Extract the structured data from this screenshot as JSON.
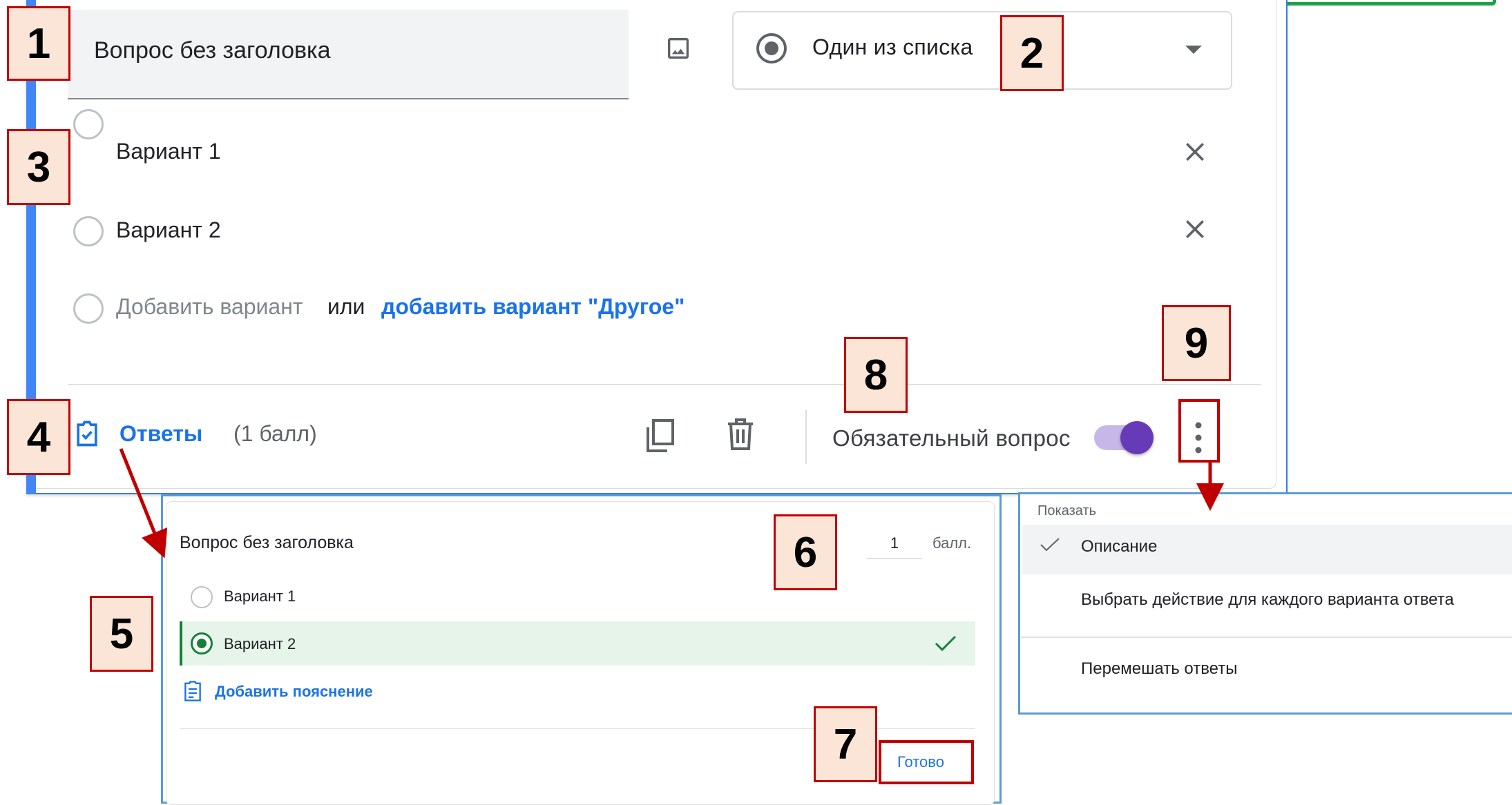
{
  "question": {
    "title": "Вопрос без заголовка",
    "type_label": "Один из списка",
    "options": [
      "Вариант 1",
      "Вариант 2"
    ],
    "add_option": "Добавить вариант",
    "or": "или",
    "add_other": "добавить вариант \"Другое\""
  },
  "footer": {
    "answers_label": "Ответы",
    "points": "(1 балл)",
    "required_label": "Обязательный вопрос",
    "required_on": true
  },
  "answers_panel": {
    "title": "Вопрос без заголовка",
    "points_value": "1",
    "points_unit": "балл.",
    "options": [
      "Вариант 1",
      "Вариант 2"
    ],
    "correct_option": "Вариант 2",
    "add_explanation": "Добавить пояснение",
    "done": "Готово"
  },
  "more_menu": {
    "header": "Показать",
    "items": [
      "Описание",
      "Выбрать действие для каждого варианта ответа",
      "Перемешать ответы"
    ],
    "checked_item": "Описание"
  },
  "annotations": [
    "1",
    "2",
    "3",
    "4",
    "5",
    "6",
    "7",
    "8",
    "9"
  ],
  "colors": {
    "accent": "#4285f4",
    "link": "#1a73e8",
    "toggle": "#673ab7",
    "correct": "#188038",
    "annotation_border": "#c00000",
    "annotation_fill": "#fbe5d6"
  },
  "icons": [
    "image-icon",
    "radio-type-icon",
    "dropdown-caret-icon",
    "close-icon",
    "answers-key-icon",
    "copy-icon",
    "trash-icon",
    "more-vert-icon",
    "check-icon",
    "note-icon"
  ]
}
